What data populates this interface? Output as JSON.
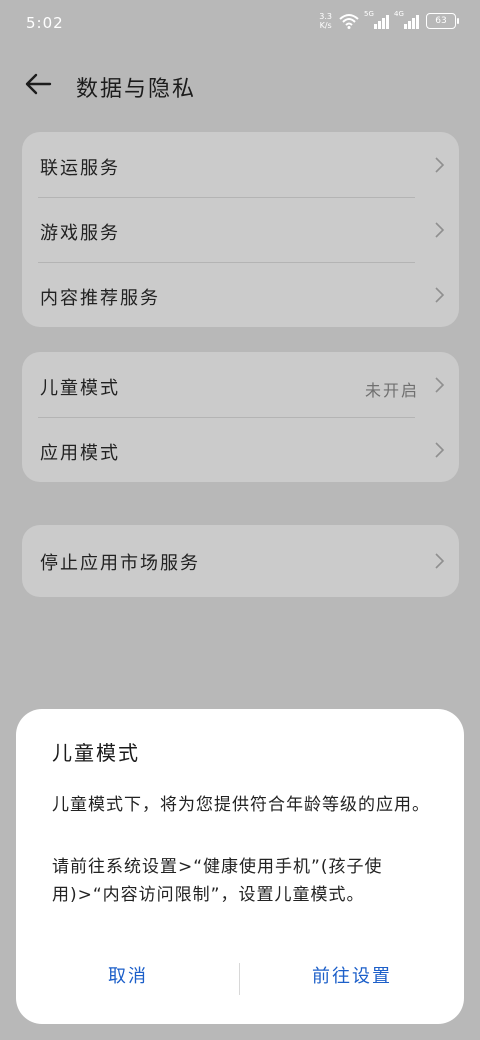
{
  "status": {
    "time": "5:02",
    "speed_value": "3.3",
    "speed_unit": "K/s",
    "sim1_label": "5G",
    "sim2_label": "4G",
    "battery": "63"
  },
  "header": {
    "title": "数据与隐私"
  },
  "groups": [
    {
      "items": [
        {
          "label": "联运服务"
        },
        {
          "label": "游戏服务"
        },
        {
          "label": "内容推荐服务"
        }
      ]
    },
    {
      "items": [
        {
          "label": "儿童模式",
          "value": "未开启"
        },
        {
          "label": "应用模式"
        }
      ]
    },
    {
      "items": [
        {
          "label": "停止应用市场服务"
        }
      ]
    }
  ],
  "dialog": {
    "title": "儿童模式",
    "paragraph1": "儿童模式下，将为您提供符合年龄等级的应用。",
    "paragraph2": "请前往系统设置>“健康使用手机”(孩子使用)>“内容访问限制”，设置儿童模式。",
    "cancel_label": "取消",
    "confirm_label": "前往设置"
  },
  "colors": {
    "accent": "#1c5fc9",
    "scrim_background": "#b8b8b8",
    "card": "#cbcbcb"
  }
}
